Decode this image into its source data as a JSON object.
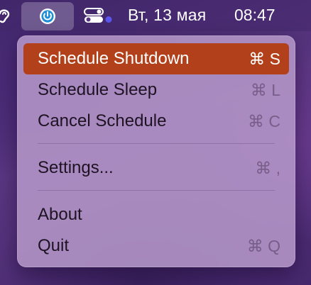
{
  "menubar": {
    "icons": [
      "ear-icon",
      "power-timer-icon",
      "control-center-icon"
    ],
    "date": "Вт, 13 мая",
    "time": "08:47"
  },
  "menu": {
    "items": [
      {
        "label": "Schedule Shutdown",
        "shortcut": "⌘ S",
        "selected": true
      },
      {
        "label": "Schedule Sleep",
        "shortcut": "⌘ L",
        "selected": false
      },
      {
        "label": "Cancel Schedule",
        "shortcut": "⌘ C",
        "selected": false
      },
      {
        "label": "Settings...",
        "shortcut": "⌘ ,",
        "selected": false
      },
      {
        "label": "About",
        "shortcut": "",
        "selected": false
      },
      {
        "label": "Quit",
        "shortcut": "⌘ Q",
        "selected": false
      }
    ]
  },
  "colors": {
    "highlight": "#b2411b",
    "accent_dot": "#5b56f0"
  }
}
